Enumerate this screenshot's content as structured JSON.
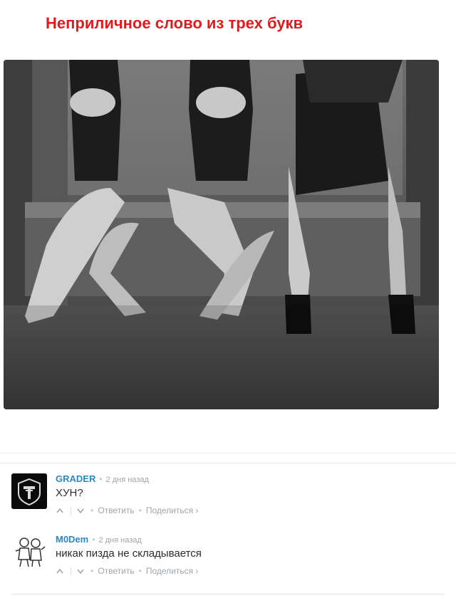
{
  "post": {
    "title": "Неприличное слово из трех букв"
  },
  "comments": [
    {
      "author": "GRADER",
      "time": "2 дня назад",
      "text": "ХУН?",
      "reply_label": "Ответить",
      "share_label": "Поделиться ›",
      "avatar_icon": "world-of-tanks-logo"
    },
    {
      "author": "M0Dem",
      "time": "2 дня назад",
      "text": "никак пизда не складывается",
      "reply_label": "Ответить",
      "share_label": "Поделиться ›",
      "avatar_icon": "cartoon-figure-avatar"
    }
  ],
  "colors": {
    "title": "#e01b1b",
    "author": "#2a88bf",
    "meta": "#a0a5aa"
  }
}
